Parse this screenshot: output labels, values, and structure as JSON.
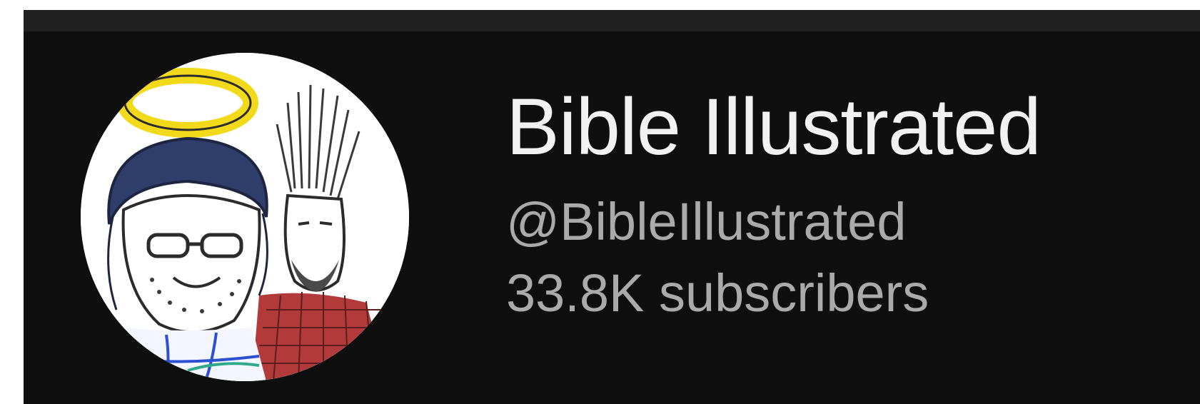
{
  "channel": {
    "name": "Bible Illustrated",
    "handle": "@BibleIllustrated",
    "subscribers": "33.8K subscribers",
    "avatar_icon": "channel-avatar-cartoon"
  },
  "colors": {
    "background": "#0f0f0f",
    "topbar": "#202020",
    "title_text": "#f1f1f1",
    "secondary_text": "#aaaaaa",
    "halo": "#f2d91a"
  }
}
